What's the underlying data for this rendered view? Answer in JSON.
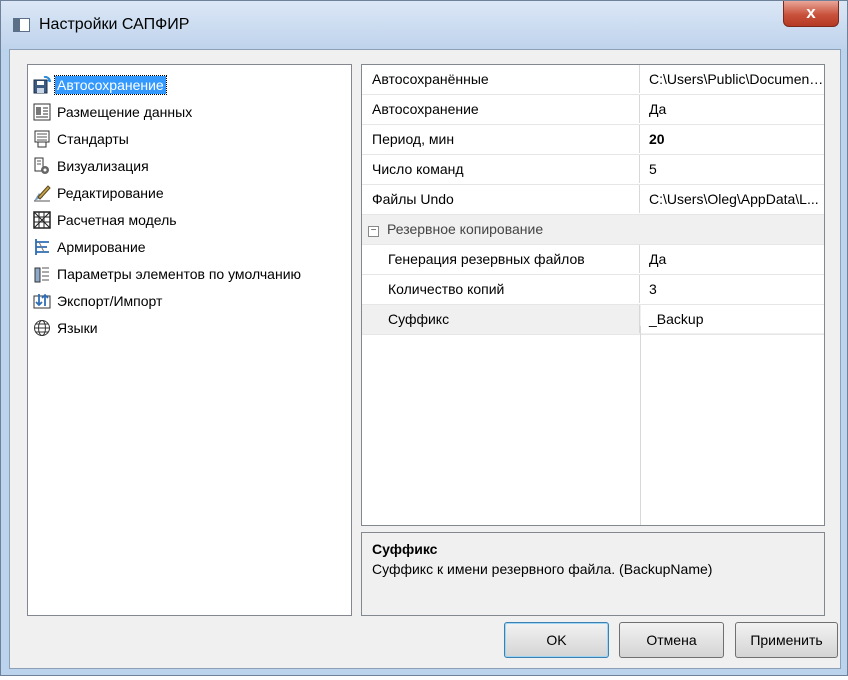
{
  "window": {
    "title": "Настройки САПФИР",
    "close_label": "x"
  },
  "tree": {
    "items": [
      {
        "label": "Автосохранение",
        "icon": "autosave-icon",
        "selected": true
      },
      {
        "label": "Размещение данных",
        "icon": "data-placement-icon"
      },
      {
        "label": "Стандарты",
        "icon": "standards-icon"
      },
      {
        "label": "Визуализация",
        "icon": "visualization-icon"
      },
      {
        "label": "Редактирование",
        "icon": "editing-icon"
      },
      {
        "label": "Расчетная модель",
        "icon": "calc-model-icon"
      },
      {
        "label": "Армирование",
        "icon": "reinforcement-icon"
      },
      {
        "label": "Параметры элементов по умолчанию",
        "icon": "default-params-icon"
      },
      {
        "label": "Экспорт/Импорт",
        "icon": "export-import-icon"
      },
      {
        "label": "Языки",
        "icon": "globe-icon"
      }
    ]
  },
  "properties": {
    "rows": [
      {
        "name": "Автосохранённые",
        "value": "C:\\Users\\Public\\Document..."
      },
      {
        "name": "Автосохранение",
        "value": "Да"
      },
      {
        "name": "Период, мин",
        "value": "20"
      },
      {
        "name": "Число команд",
        "value": "5"
      },
      {
        "name": "Файлы Undo",
        "value": "C:\\Users\\Oleg\\AppData\\L..."
      }
    ],
    "category": {
      "toggle": "⊟",
      "label": "Резервное копирование"
    },
    "sub_rows": [
      {
        "name": "Генерация резервных файлов",
        "value": "Да"
      },
      {
        "name": "Количество копий",
        "value": "3"
      },
      {
        "name": "Суффикс",
        "value": "_Backup"
      }
    ]
  },
  "description": {
    "title": "Суффикс",
    "text": "Суффикс к имени резервного файла. (BackupName)"
  },
  "buttons": {
    "ok": "OK",
    "cancel": "Отмена",
    "apply": "Применить"
  }
}
